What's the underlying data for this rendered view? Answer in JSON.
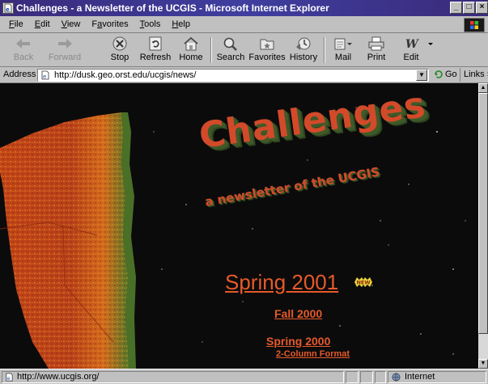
{
  "window": {
    "title": "Challenges - a Newsletter of the UCGIS - Microsoft Internet Explorer",
    "controls": [
      "_",
      "□",
      "×"
    ]
  },
  "menu": {
    "items": [
      {
        "label": "File",
        "accel": "F",
        "rest": "ile"
      },
      {
        "label": "Edit",
        "accel": "E",
        "rest": "dit"
      },
      {
        "label": "View",
        "accel": "V",
        "rest": "iew"
      },
      {
        "label": "Favorites",
        "accel": "a",
        "pre": "F",
        "rest": "vorites"
      },
      {
        "label": "Tools",
        "accel": "T",
        "rest": "ools"
      },
      {
        "label": "Help",
        "accel": "H",
        "rest": "elp"
      }
    ]
  },
  "toolbar": {
    "back_label": "Back",
    "forward_label": "Forward",
    "stop_label": "Stop",
    "refresh_label": "Refresh",
    "home_label": "Home",
    "search_label": "Search",
    "favorites_label": "Favorites",
    "history_label": "History",
    "mail_label": "Mail",
    "print_label": "Print",
    "edit_label": "Edit"
  },
  "address": {
    "label": "Address",
    "url": "http://dusk.geo.orst.edu/ucgis/news/",
    "go_label": "Go",
    "links_label": "Links"
  },
  "page": {
    "logo_title": "Challenges",
    "logo_subtitle": "a newsletter of the UCGIS",
    "links": {
      "spring2001": "Spring 2001",
      "fall2000": "Fall 2000",
      "spring2000": "Spring 2000",
      "two_column": "2-Column Format"
    },
    "new_badge": "NEW",
    "colors": {
      "background": "#0b0b0c",
      "link": "#e65a2a",
      "logo_face": "#d24a2a",
      "logo_extrusion": "#3e5a28"
    }
  },
  "status": {
    "text": "http://www.ucgis.org/",
    "zone": "Internet"
  }
}
